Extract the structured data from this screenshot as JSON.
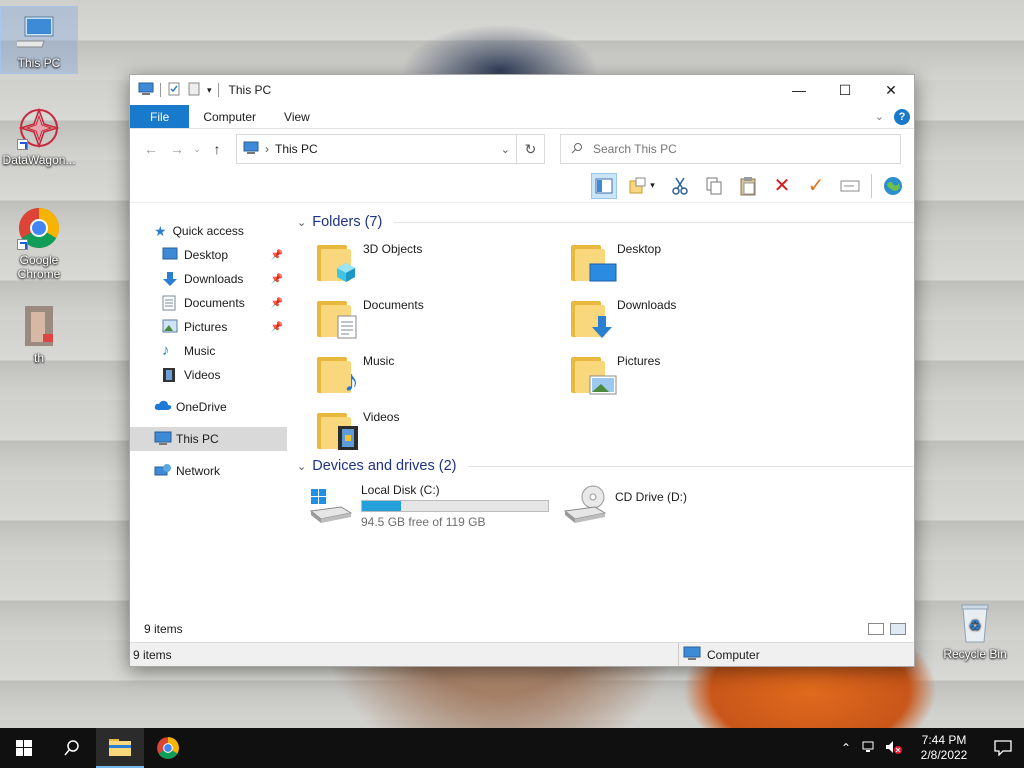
{
  "desktop": {
    "icons": [
      {
        "label": "This PC"
      },
      {
        "label": "DataWagon..."
      },
      {
        "label": "Google Chrome"
      },
      {
        "label": "th"
      },
      {
        "label": "Recycle Bin"
      }
    ]
  },
  "window": {
    "title": "This PC",
    "controls": {
      "minimize": "—",
      "maximize": "☐",
      "close": "✕"
    },
    "ribbon": {
      "tabs": [
        "File",
        "Computer",
        "View"
      ],
      "help": "?"
    },
    "address": {
      "path": "This PC",
      "separator": "›"
    },
    "search": {
      "placeholder": "Search This PC"
    },
    "nav": {
      "quick_access": "Quick access",
      "quick_items": [
        "Desktop",
        "Downloads",
        "Documents",
        "Pictures",
        "Music",
        "Videos"
      ],
      "onedrive": "OneDrive",
      "this_pc": "This PC",
      "network": "Network"
    },
    "groups": {
      "folders_header": "Folders (7)",
      "folders": [
        "3D Objects",
        "Desktop",
        "Documents",
        "Downloads",
        "Music",
        "Pictures",
        "Videos"
      ],
      "devices_header": "Devices and drives (2)",
      "drives": [
        {
          "name": "Local Disk (C:)",
          "free": "94.5 GB free of 119 GB",
          "used_fraction": 0.21
        },
        {
          "name": "CD Drive (D:)"
        }
      ]
    },
    "status": {
      "items_inner": "9 items",
      "items_outer": "9 items",
      "zone": "Computer"
    }
  },
  "taskbar": {
    "time": "7:44 PM",
    "date": "2/8/2022"
  },
  "colors": {
    "accent": "#1979ca",
    "folder": "#f9d77c",
    "drive_fill": "#26a0da"
  }
}
